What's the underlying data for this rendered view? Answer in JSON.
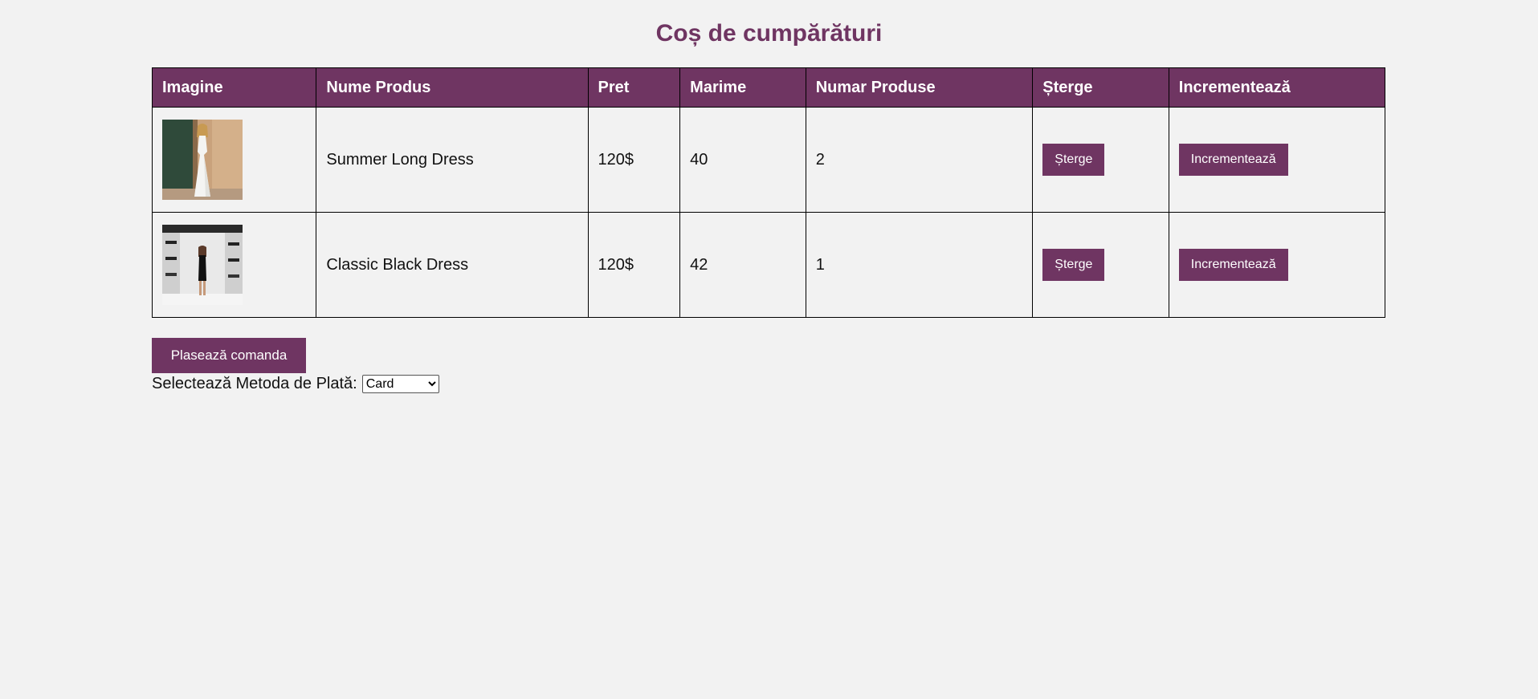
{
  "page": {
    "title": "Coș de cumpărături"
  },
  "table": {
    "headers": [
      "Imagine",
      "Nume Produs",
      "Pret",
      "Marime",
      "Numar Produse",
      "Șterge",
      "Incrementează"
    ],
    "rows": [
      {
        "image_name": "white-dress-product-image",
        "name": "Summer Long Dress",
        "price": "120$",
        "size": "40",
        "quantity": "2",
        "delete_label": "Șterge",
        "increment_label": "Incrementează"
      },
      {
        "image_name": "black-dress-product-image",
        "name": "Classic Black Dress",
        "price": "120$",
        "size": "42",
        "quantity": "1",
        "delete_label": "Șterge",
        "increment_label": "Incrementează"
      }
    ]
  },
  "order": {
    "button_label": "Plasează comanda"
  },
  "payment": {
    "label": "Selectează Metoda de Plată:",
    "selected": "Card"
  },
  "colors": {
    "accent": "#6f3562",
    "background": "#f2f2f2"
  }
}
